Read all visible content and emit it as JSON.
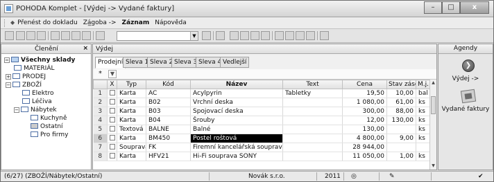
{
  "window": {
    "title": "POHODA Komplet - [Výdej -> Vydané faktury]",
    "minimize": "–",
    "maximize": "□",
    "close": "x"
  },
  "menu": {
    "items": [
      "Přenést do dokladu",
      "Zá̲goba ->",
      "Záznam",
      "Nápověda"
    ]
  },
  "left_pane": {
    "header": "Členění",
    "close": "×",
    "tree": [
      {
        "label": "Všechny sklady",
        "bold": true
      },
      {
        "label": "MATERIÁL"
      },
      {
        "label": "PRODEJ"
      },
      {
        "label": "ZBOŽÍ"
      },
      {
        "label": "Elektro"
      },
      {
        "label": "Léčiva"
      },
      {
        "label": "Nábytek"
      },
      {
        "label": "Kuchyně"
      },
      {
        "label": "Ostatní"
      },
      {
        "label": "Pro firmy"
      }
    ]
  },
  "main": {
    "header": "Výdej",
    "tabs": [
      "Prodejní",
      "Sleva 1",
      "Sleva 2",
      "Sleva 3",
      "Sleva 4",
      "Vedlejší"
    ],
    "filter_star": "*",
    "columns": [
      "",
      "X",
      "Typ",
      "Kód",
      "Název",
      "Text",
      "Cena",
      "Stav zásoby",
      "M.j."
    ],
    "rows": [
      {
        "n": "1",
        "typ": "Karta",
        "kod": "AC",
        "nazev": "Acylpyrin",
        "text": "Tabletky",
        "cena": "19,50",
        "stav": "10,00",
        "mj": "bal"
      },
      {
        "n": "2",
        "typ": "Karta",
        "kod": "B02",
        "nazev": "Vrchní deska",
        "text": "",
        "cena": "1 080,00",
        "stav": "61,00",
        "mj": "ks"
      },
      {
        "n": "3",
        "typ": "Karta",
        "kod": "B03",
        "nazev": "Spojovací deska",
        "text": "",
        "cena": "300,00",
        "stav": "88,00",
        "mj": "ks"
      },
      {
        "n": "4",
        "typ": "Karta",
        "kod": "B04",
        "nazev": "Šrouby",
        "text": "",
        "cena": "12,00",
        "stav": "130,00",
        "mj": "ks"
      },
      {
        "n": "5",
        "typ": "Textová",
        "kod": "BALNE",
        "nazev": "Balné",
        "text": "",
        "cena": "130,00",
        "stav": "",
        "mj": "ks"
      },
      {
        "n": "6",
        "typ": "Karta",
        "kod": "BM450",
        "nazev": "Postel roštová",
        "text": "",
        "cena": "4 800,00",
        "stav": "9,00",
        "mj": "ks"
      },
      {
        "n": "7",
        "typ": "Souprava",
        "kod": "FK",
        "nazev": "Firemní kancelářská souprava",
        "text": "",
        "cena": "28 944,00",
        "stav": "",
        "mj": ""
      },
      {
        "n": "8",
        "typ": "Karta",
        "kod": "HFV21",
        "nazev": "Hi-Fi souprava SONY",
        "text": "",
        "cena": "11 050,00",
        "stav": "1,00",
        "mj": "ks"
      }
    ]
  },
  "agenda": {
    "header": "Agendy",
    "items": [
      "Výdej ->",
      "Vydané faktury"
    ]
  },
  "status": {
    "path": "(6/27) (ZBOŽÍ/Nábytek/Ostatní)",
    "company": "Novák s.r.o.",
    "year": "2011"
  }
}
